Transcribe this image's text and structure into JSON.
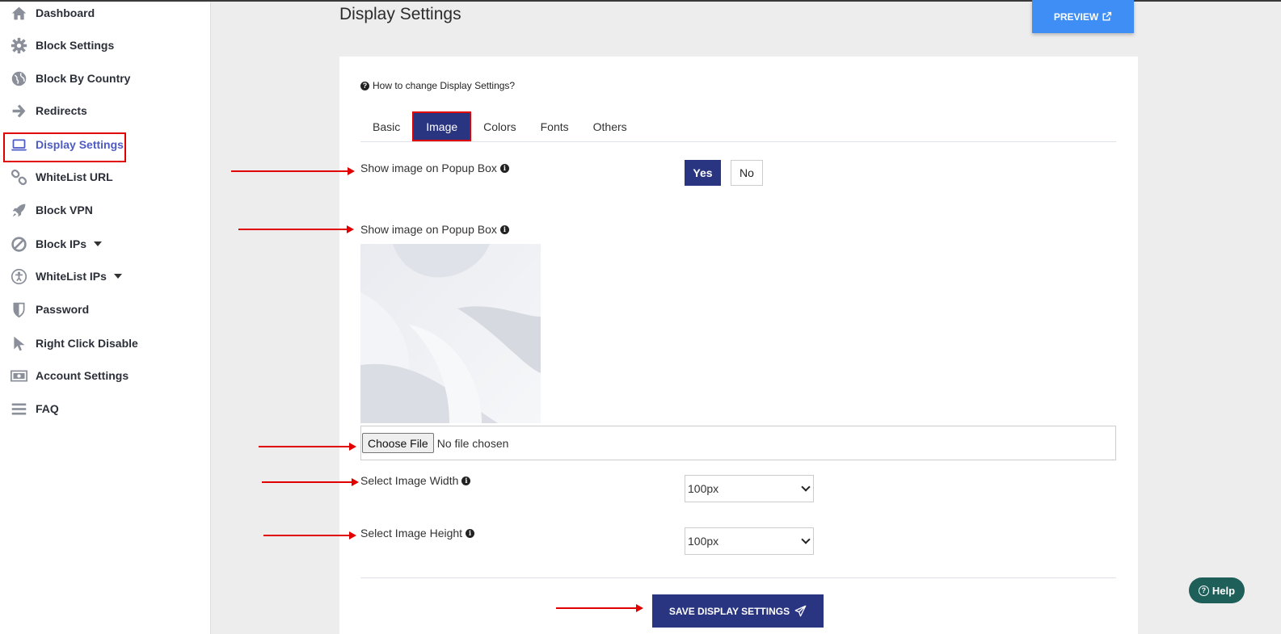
{
  "sidebar": {
    "items": [
      {
        "label": "Dashboard",
        "icon": "home-icon"
      },
      {
        "label": "Block Settings",
        "icon": "gear-icon"
      },
      {
        "label": "Block By Country",
        "icon": "globe-icon"
      },
      {
        "label": "Redirects",
        "icon": "arrow-right-icon"
      },
      {
        "label": "Display Settings",
        "icon": "laptop-icon"
      },
      {
        "label": "WhiteList URL",
        "icon": "link-icon"
      },
      {
        "label": "Block VPN",
        "icon": "rocket-icon"
      },
      {
        "label": "Block IPs",
        "icon": "ban-icon"
      },
      {
        "label": "WhiteList IPs",
        "icon": "accessibility-icon"
      },
      {
        "label": "Password",
        "icon": "shield-icon"
      },
      {
        "label": "Right Click Disable",
        "icon": "cursor-icon"
      },
      {
        "label": "Account Settings",
        "icon": "money-bill-icon"
      },
      {
        "label": "FAQ",
        "icon": "bars-icon"
      }
    ]
  },
  "header": {
    "title": "Display Settings",
    "preview_label": "PREVIEW"
  },
  "card": {
    "howto_label": "How to change Display Settings?",
    "tabs": [
      "Basic",
      "Image",
      "Colors",
      "Fonts",
      "Others"
    ],
    "show_image_label": "Show image on Popup Box",
    "yes_label": "Yes",
    "no_label": "No",
    "image_label": "Show image on Popup Box",
    "choose_file_label": "Choose File",
    "file_status": "No file chosen",
    "width_label": "Select Image Width",
    "width_value": "100px",
    "height_label": "Select Image Height",
    "height_value": "100px",
    "save_label": "SAVE DISPLAY SETTINGS"
  },
  "help_label": "Help",
  "colors": {
    "primary": "#2a3582",
    "preview": "#3f8ef6",
    "annotation": "#e00000",
    "help": "#1e5f5a",
    "active_nav": "#4e5bc4"
  }
}
